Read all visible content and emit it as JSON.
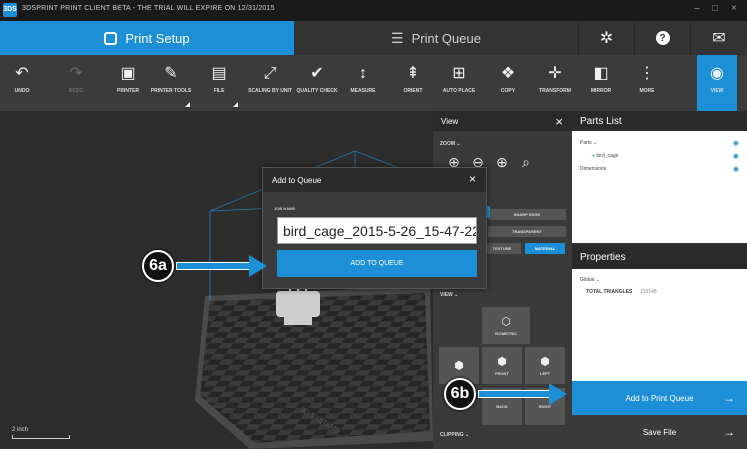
{
  "window": {
    "title": "3DSPRINT PRINT CLIENT BETA - THE TRIAL WILL EXPIRE ON 12/31/2015",
    "logo_text": "3DS",
    "minimize": "–",
    "maximize": "□",
    "close": "×"
  },
  "main_tabs": {
    "setup_label": "Print Setup",
    "queue_label": "Print Queue"
  },
  "top_icons": [
    "gear-icon",
    "help-icon",
    "mail-icon"
  ],
  "toolbar": [
    {
      "label": "UNDO",
      "icon": "↶"
    },
    {
      "label": "REDO",
      "icon": "↷"
    },
    {
      "label": "PRINTER",
      "icon": "▣"
    },
    {
      "label": "PRINTER TOOLS",
      "icon": "✎"
    },
    {
      "label": "FILE",
      "icon": "▤"
    },
    {
      "label": "SCALING BY UNIT",
      "icon": "⤢"
    },
    {
      "label": "QUALITY CHECK",
      "icon": "✔"
    },
    {
      "label": "MEASURE",
      "icon": "↕"
    },
    {
      "label": "ORIENT",
      "icon": "⇞"
    },
    {
      "label": "AUTO PLACE",
      "icon": "⊞"
    },
    {
      "label": "COPY",
      "icon": "❖"
    },
    {
      "label": "TRANSFORM",
      "icon": "✛"
    },
    {
      "label": "MIRROR",
      "icon": "◧"
    },
    {
      "label": "MORE",
      "icon": "⋮"
    },
    {
      "label": "VIEW",
      "icon": "◉"
    }
  ],
  "viewport": {
    "ruler_label": "2 inch"
  },
  "view_panel": {
    "title": "View",
    "zoom_label": "ZOOM",
    "render_buttons": [
      "SHARP EDGE",
      "TRANSPARENT"
    ],
    "texture_buttons": [
      "TEXTURE",
      "MATERIAL"
    ],
    "view_label": "VIEW",
    "views": [
      "ISOMETRIC",
      "FRONT",
      "LEFT",
      "BACK",
      "RIGHT"
    ],
    "clipping_label": "CLIPPING"
  },
  "parts_list": {
    "title": "Parts List",
    "parts_label": "Parts",
    "part_name": "bird_cage",
    "dimensions_label": "Dimensions"
  },
  "properties": {
    "title": "Properties",
    "global_label": "Global",
    "triangles_label": "TOTAL TRIANGLES",
    "triangles_value": "153148"
  },
  "actions": {
    "add_to_print_queue": "Add to Print Queue",
    "save_file": "Save File"
  },
  "modal": {
    "title": "Add to Queue",
    "job_name_label": "JOB NAME",
    "job_name_value": "bird_cage_2015-5-26_15-47-22",
    "add_button": "ADD TO QUEUE"
  },
  "callouts": {
    "a": "6a",
    "b": "6b"
  },
  "colors": {
    "accent": "#1d8fd6"
  }
}
